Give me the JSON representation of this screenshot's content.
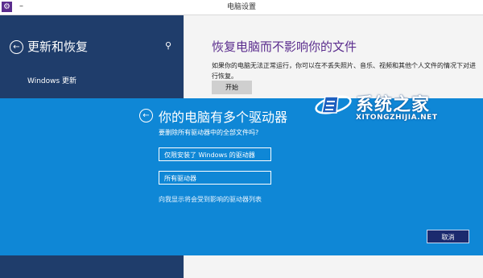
{
  "window": {
    "title": "电脑设置",
    "minimize_glyph": "–",
    "app_icon": "gear-icon"
  },
  "left_pane": {
    "heading": "更新和恢复",
    "back_icon": "back-arrow-icon",
    "search_icon": "search-icon",
    "items": [
      {
        "label": "Windows 更新"
      }
    ]
  },
  "right_pane": {
    "title": "恢复电脑而不影响你的文件",
    "description": "如果你的电脑无法正常运行，你可以在不丢失照片、音乐、视频和其他个人文件的情况下对进行恢复。",
    "start_button": "开始"
  },
  "dialog": {
    "title": "你的电脑有多个驱动器",
    "question": "要删除所有驱动器中的全部文件吗?",
    "option_windows_drive": "仅限安装了 Windows 的驱动器",
    "option_all_drives": "所有驱动器",
    "show_list_link": "向我显示将会受到影响的驱动器列表",
    "cancel_button": "取消"
  },
  "watermark": {
    "chinese": "系统之家",
    "english": "XITONGZHIJIA.NET"
  },
  "colors": {
    "left_pane": "#1f3d6b",
    "dialog": "#0f87d6",
    "accent_title": "#5b2d8e",
    "cancel": "#1b2a6e"
  }
}
